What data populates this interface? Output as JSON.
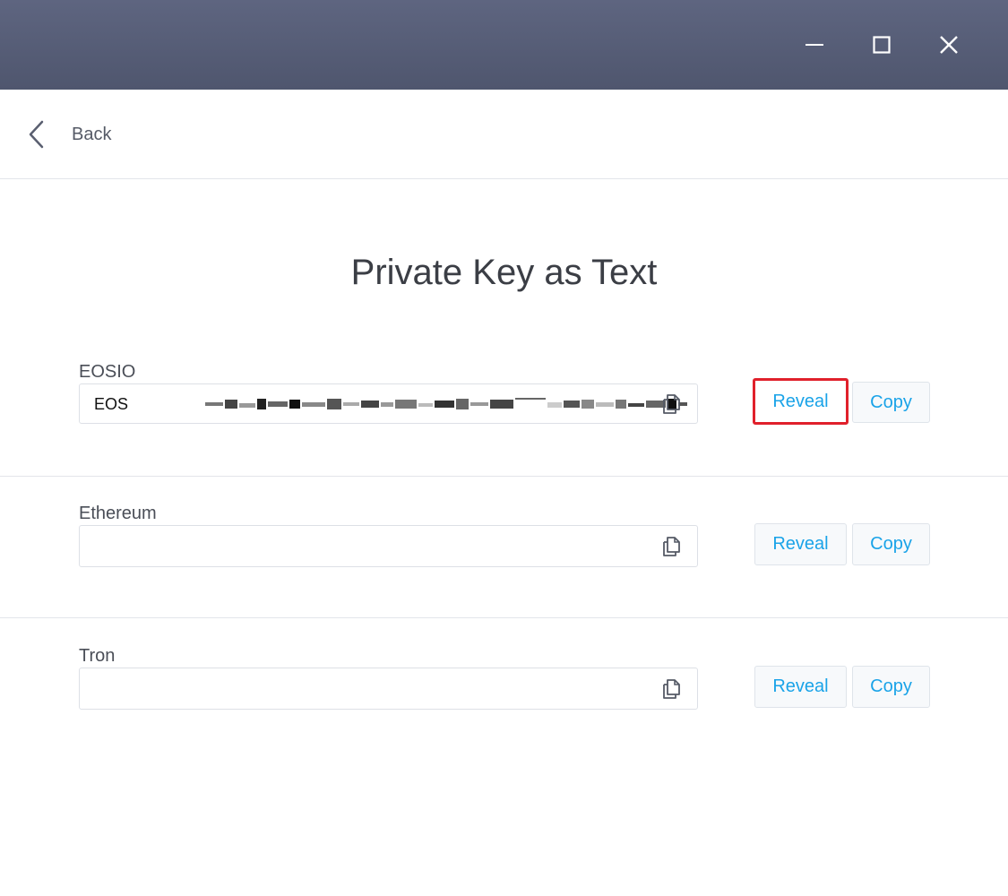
{
  "window": {
    "controls": [
      "minimize-icon",
      "maximize-icon",
      "close-icon"
    ]
  },
  "nav": {
    "back_label": "Back",
    "back_icon": "chevron-left-icon"
  },
  "page": {
    "title": "Private Key as Text"
  },
  "keys": [
    {
      "chain": "EOSIO",
      "value_prefix": "EOS",
      "masked": true,
      "reveal_label": "Reveal",
      "copy_label": "Copy",
      "field_icon": "copy-icon"
    },
    {
      "chain": "Ethereum",
      "value_prefix": "",
      "masked": false,
      "reveal_label": "Reveal",
      "copy_label": "Copy",
      "field_icon": "copy-icon"
    },
    {
      "chain": "Tron",
      "value_prefix": "",
      "masked": false,
      "reveal_label": "Reveal",
      "copy_label": "Copy",
      "field_icon": "copy-icon"
    }
  ],
  "colors": {
    "titlebar": "#565d76",
    "accent": "#1aa3e8",
    "highlight": "#e0202b",
    "divider": "#e3e5ea"
  }
}
